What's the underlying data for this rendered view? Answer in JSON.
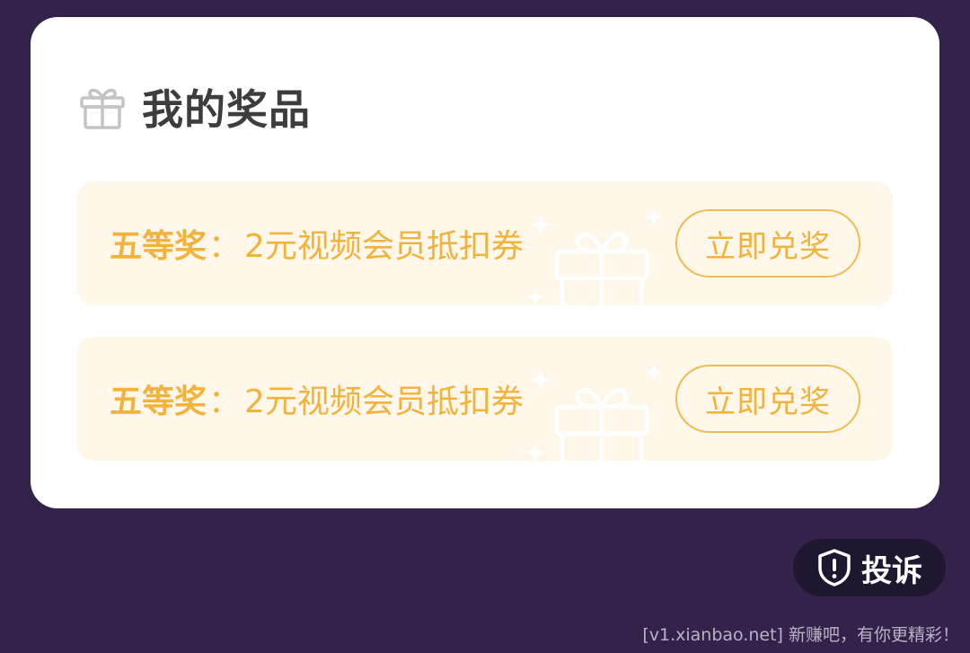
{
  "header": {
    "title": "我的奖品",
    "icon": "gift-icon"
  },
  "prizes": [
    {
      "level": "五等奖",
      "separator": "：",
      "name": "2元视频会员抵扣券",
      "action_label": "立即兑奖"
    },
    {
      "level": "五等奖",
      "separator": "：",
      "name": "2元视频会员抵扣券",
      "action_label": "立即兑奖"
    }
  ],
  "complain": {
    "label": "投诉",
    "icon": "shield-alert-icon"
  },
  "watermark": "[v1.xianbao.net] 新赚吧，有你更精彩！",
  "colors": {
    "background": "#33224a",
    "card": "#ffffff",
    "accent": "#f2b33c",
    "prize_bg": "#fff7ea"
  }
}
